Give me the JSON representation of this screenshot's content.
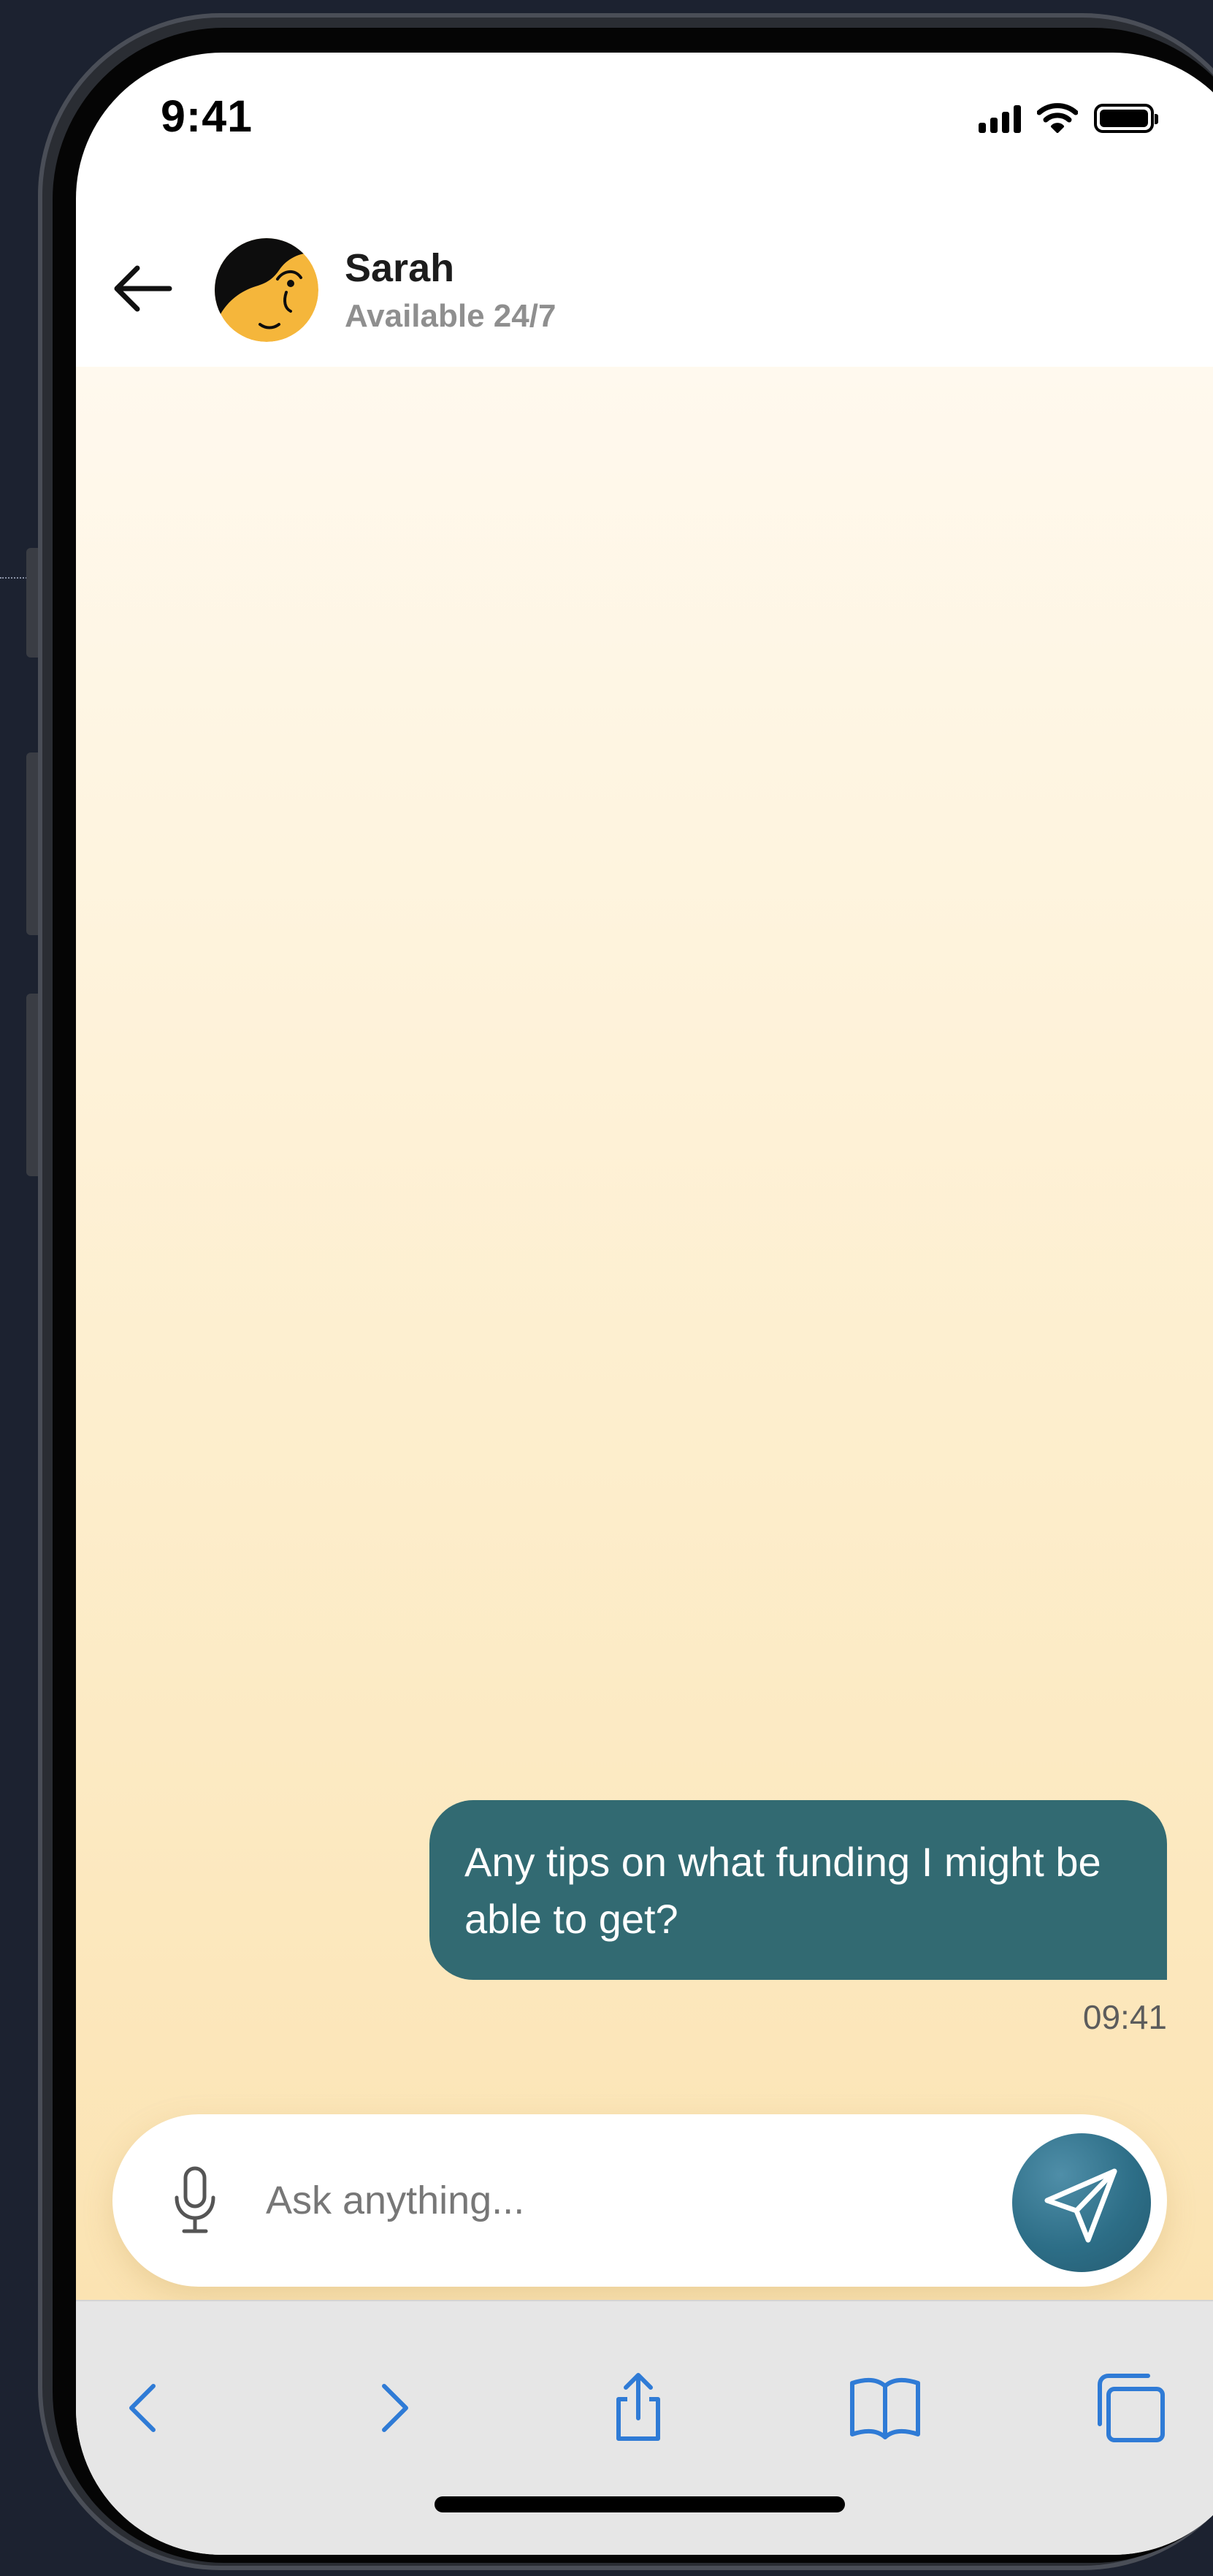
{
  "status_bar": {
    "time": "9:41",
    "icons": [
      "cellular-signal-icon",
      "wifi-icon",
      "battery-icon"
    ]
  },
  "header": {
    "contact_name": "Sarah",
    "contact_status": "Available 24/7",
    "back_icon": "arrow-left-icon",
    "avatar": "cartoon-avatar"
  },
  "conversation": {
    "messages": [
      {
        "sender": "user",
        "text": "Any tips on what funding I might be able to get?",
        "time": "09:41"
      }
    ]
  },
  "composer": {
    "placeholder": "Ask anything...",
    "value": "",
    "mic_icon": "microphone-icon",
    "send_icon": "paper-plane-icon"
  },
  "browser_toolbar": {
    "items": [
      "back-chevron-icon",
      "forward-chevron-icon",
      "share-icon",
      "bookmarks-icon",
      "tabs-icon"
    ]
  },
  "colors": {
    "accent": "#326a72",
    "send_button": "#2d6e87",
    "toolbar_icon": "#2f7bd6",
    "chat_bg_top": "#fff9ee",
    "chat_bg_bottom": "#fbe3b2",
    "avatar_yellow": "#f5b63b"
  }
}
